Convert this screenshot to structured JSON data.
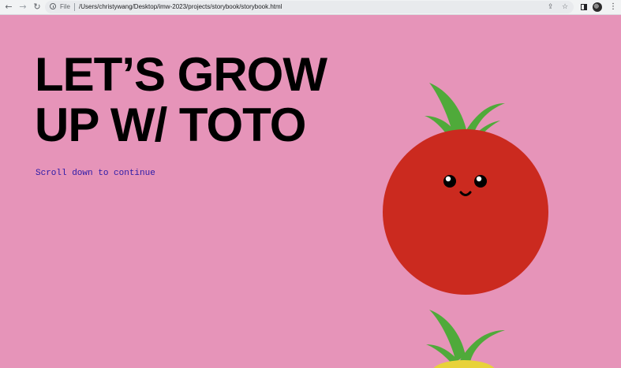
{
  "browser": {
    "scheme_label": "File",
    "url": "/Users/christywang/Desktop/imw-2023/projects/storybook/storybook.html",
    "icons": {
      "back": "arrow-left-icon",
      "forward": "arrow-right-icon",
      "reload": "reload-icon",
      "info": "info-icon",
      "share": "share-icon",
      "bookmark": "star-icon",
      "side_panel": "side-panel-icon",
      "profile": "avatar",
      "menu": "more-vert-icon"
    }
  },
  "page": {
    "background": "#e694b9",
    "title_line1": "LET’S GROW",
    "title_line2": "UP W/ TOTO",
    "scroll_hint": "Scroll down to continue",
    "colors": {
      "tomato": "#cb2a1f",
      "leaves": "#4faa3a",
      "fruit_below": "#e8d23a",
      "link": "#2a1aa8"
    }
  }
}
